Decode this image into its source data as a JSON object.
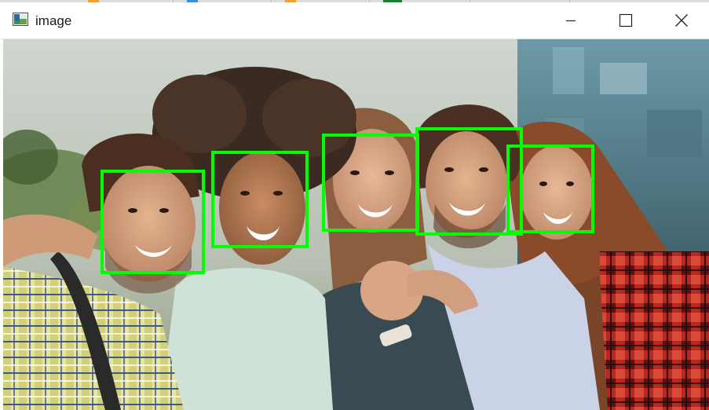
{
  "window": {
    "title": "image",
    "icon": "image-window-icon",
    "controls": {
      "minimize_icon": "minimize-icon",
      "maximize_icon": "maximize-icon",
      "close_icon": "close-icon"
    }
  },
  "content": {
    "image_description_key": "group-photo",
    "face_box_color": "#00ff00",
    "face_count": 5
  }
}
